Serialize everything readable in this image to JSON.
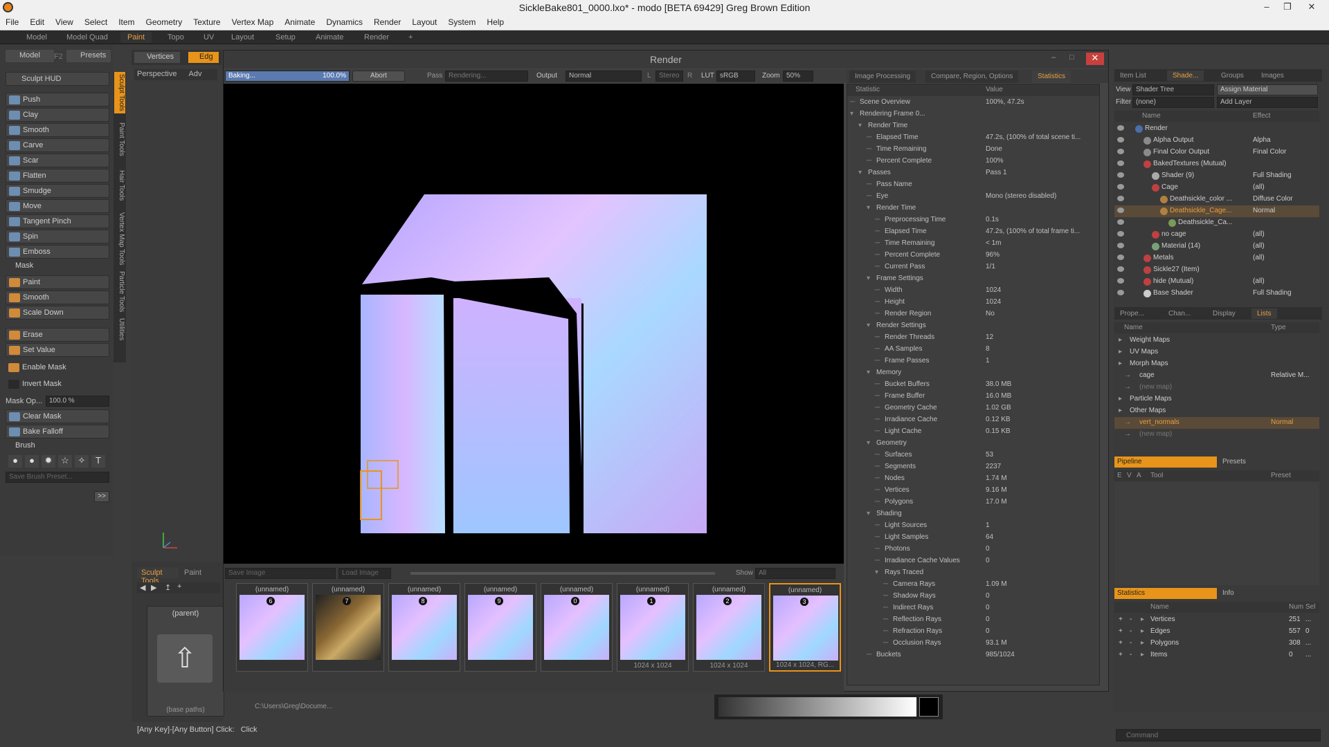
{
  "window": {
    "title": "SickleBake801_0000.lxo* - modo [BETA 69429] Greg Brown Edition"
  },
  "menu": [
    "File",
    "Edit",
    "View",
    "Select",
    "Item",
    "Geometry",
    "Texture",
    "Vertex Map",
    "Animate",
    "Dynamics",
    "Render",
    "Layout",
    "System",
    "Help"
  ],
  "layout_tabs": [
    "Model",
    "Model Quad",
    "Paint",
    "Topo",
    "UV",
    "Layout",
    "Setup",
    "Animate",
    "Render"
  ],
  "left": {
    "mode_tabs": [
      "Model",
      "F2",
      "Presets",
      "F6"
    ],
    "hud": "Sculpt HUD",
    "tools": [
      "Push",
      "Clay",
      "Smooth",
      "Carve",
      "Scar",
      "Flatten",
      "Smudge",
      "Move",
      "Tangent Pinch",
      "Spin",
      "Emboss"
    ],
    "mask_title": "Mask",
    "mask_tools": [
      "Paint",
      "Smooth",
      "Scale Down"
    ],
    "erase": "Erase",
    "set_value": "Set Value",
    "enable_mask": "Enable Mask",
    "invert_mask": "Invert Mask",
    "mask_opacity_label": "Mask Op...",
    "mask_opacity": "100.0 %",
    "clear_mask": "Clear Mask",
    "bake_falloff": "Bake Falloff",
    "brush_title": "Brush",
    "save_brush": "Save Brush Preset...",
    "vtabs": [
      "Sculpt Tools",
      "Paint Tools",
      "Hair Tools",
      "Vertex Map Tools",
      "Particle Tools",
      "Utilities"
    ],
    "bottom_tabs": [
      "Sculpt Tools",
      "Paint"
    ],
    "preset_label": "(parent)",
    "preset_path": "(base paths)"
  },
  "viewport": {
    "mode": "Perspective",
    "adv": "Adv",
    "sel_vertices": "Vertices",
    "sel_edges": "Edg"
  },
  "render": {
    "title": "Render",
    "progress_label": "Baking...",
    "progress_value": "100.0%",
    "progress_fraction": 1.0,
    "abort": "Abort",
    "pass_label": "Pass",
    "pass_value": "Rendering...",
    "output_label": "Output",
    "output_value": "Normal",
    "l": "L",
    "stereo": "Stereo",
    "r": "R",
    "lut_label": "LUT",
    "lut_value": "sRGB",
    "zoom_label": "Zoom",
    "zoom_value": "50%",
    "save_image": "Save Image",
    "load_image": "Load Image",
    "show_label": "Show",
    "show_value": "All",
    "tabs": [
      "Image Processing",
      "Compare, Region, Options",
      "Statistics"
    ],
    "stats_head": [
      "Statistic",
      "Value"
    ],
    "stats": [
      {
        "k": "Scene Overview",
        "v": "100%, 47.2s",
        "l": 0
      },
      {
        "k": "Rendering Frame 0...",
        "v": "",
        "l": 0
      },
      {
        "k": "Render Time",
        "v": "",
        "l": 1
      },
      {
        "k": "Elapsed Time",
        "v": "47.2s, (100% of total scene ti...",
        "l": 2
      },
      {
        "k": "Time Remaining",
        "v": "Done",
        "l": 2
      },
      {
        "k": "Percent Complete",
        "v": "100%",
        "l": 2
      },
      {
        "k": "Passes",
        "v": "Pass 1",
        "l": 1
      },
      {
        "k": "Pass Name",
        "v": "",
        "l": 2
      },
      {
        "k": "Eye",
        "v": "Mono (stereo disabled)",
        "l": 2
      },
      {
        "k": "Render Time",
        "v": "",
        "l": 2
      },
      {
        "k": "Preprocessing Time",
        "v": "0.1s",
        "l": 3
      },
      {
        "k": "Elapsed Time",
        "v": "47.2s, (100% of total frame ti...",
        "l": 3
      },
      {
        "k": "Time Remaining",
        "v": "< 1m",
        "l": 3
      },
      {
        "k": "Percent Complete",
        "v": "96%",
        "l": 3
      },
      {
        "k": "Current Pass",
        "v": "1/1",
        "l": 3
      },
      {
        "k": "Frame Settings",
        "v": "",
        "l": 2
      },
      {
        "k": "Width",
        "v": "1024",
        "l": 3
      },
      {
        "k": "Height",
        "v": "1024",
        "l": 3
      },
      {
        "k": "Render Region",
        "v": "No",
        "l": 3
      },
      {
        "k": "Render Settings",
        "v": "",
        "l": 2
      },
      {
        "k": "Render Threads",
        "v": "12",
        "l": 3
      },
      {
        "k": "AA Samples",
        "v": "8",
        "l": 3
      },
      {
        "k": "Frame Passes",
        "v": "1",
        "l": 3
      },
      {
        "k": "Memory",
        "v": "",
        "l": 2
      },
      {
        "k": "Bucket Buffers",
        "v": "38.0 MB",
        "l": 3
      },
      {
        "k": "Frame Buffer",
        "v": "16.0 MB",
        "l": 3
      },
      {
        "k": "Geometry Cache",
        "v": "1.02 GB",
        "l": 3
      },
      {
        "k": "Irradiance Cache",
        "v": "0.12 KB",
        "l": 3
      },
      {
        "k": "Light Cache",
        "v": "0.15 KB",
        "l": 3
      },
      {
        "k": "Geometry",
        "v": "",
        "l": 2
      },
      {
        "k": "Surfaces",
        "v": "53",
        "l": 3
      },
      {
        "k": "Segments",
        "v": "2237",
        "l": 3
      },
      {
        "k": "Nodes",
        "v": "1.74 M",
        "l": 3
      },
      {
        "k": "Vertices",
        "v": "9.16 M",
        "l": 3
      },
      {
        "k": "Polygons",
        "v": "17.0 M",
        "l": 3
      },
      {
        "k": "Shading",
        "v": "",
        "l": 2
      },
      {
        "k": "Light Sources",
        "v": "1",
        "l": 3
      },
      {
        "k": "Light Samples",
        "v": "64",
        "l": 3
      },
      {
        "k": "Photons",
        "v": "0",
        "l": 3
      },
      {
        "k": "Irradiance Cache Values",
        "v": "0",
        "l": 3
      },
      {
        "k": "Rays Traced",
        "v": "",
        "l": 3
      },
      {
        "k": "Camera Rays",
        "v": "1.09 M",
        "l": 4
      },
      {
        "k": "Shadow Rays",
        "v": "0",
        "l": 4
      },
      {
        "k": "Indirect Rays",
        "v": "0",
        "l": 4
      },
      {
        "k": "Reflection Rays",
        "v": "0",
        "l": 4
      },
      {
        "k": "Refraction Rays",
        "v": "0",
        "l": 4
      },
      {
        "k": "Occlusion Rays",
        "v": "93.1 M",
        "l": 4
      },
      {
        "k": "Buckets",
        "v": "985/1024",
        "l": 2
      }
    ],
    "thumbs": [
      {
        "label": "(unnamed)",
        "num": "6",
        "size": ""
      },
      {
        "label": "(unnamed)",
        "num": "7",
        "size": ""
      },
      {
        "label": "(unnamed)",
        "num": "8",
        "size": ""
      },
      {
        "label": "(unnamed)",
        "num": "9",
        "size": ""
      },
      {
        "label": "(unnamed)",
        "num": "0",
        "size": ""
      },
      {
        "label": "(unnamed)",
        "num": "1",
        "size": "1024 x 1024"
      },
      {
        "label": "(unnamed)",
        "num": "2",
        "size": "1024 x 1024"
      },
      {
        "label": "(unnamed)",
        "num": "3",
        "size": "1024 x 1024, RG..."
      }
    ]
  },
  "right": {
    "top_tabs": [
      "Item List",
      "Shade...",
      "Groups",
      "Images"
    ],
    "view_label": "View",
    "view_value": "Shader Tree",
    "assign_material": "Assign Material",
    "filter_label": "Filter",
    "filter_value": "(none)",
    "add_layer": "Add Layer",
    "cols": [
      "Name",
      "Effect"
    ],
    "items": [
      {
        "n": "Render",
        "e": "",
        "l": 0,
        "c": "#4a6ea8"
      },
      {
        "n": "Alpha Output",
        "e": "Alpha",
        "l": 1,
        "c": "#8a8a8a"
      },
      {
        "n": "Final Color Output",
        "e": "Final Color",
        "l": 1,
        "c": "#8a8a8a"
      },
      {
        "n": "BakedTextures (Mutual)",
        "e": "",
        "l": 1,
        "c": "#c04040"
      },
      {
        "n": "Shader (9)",
        "e": "Full Shading",
        "l": 2,
        "c": "#aaaaaa"
      },
      {
        "n": "Cage",
        "e": "(all)",
        "l": 2,
        "c": "#c04040"
      },
      {
        "n": "Deathsickle_color ...",
        "e": "Diffuse Color",
        "l": 3,
        "c": "#b08040"
      },
      {
        "n": "Deathsickle_Cage...",
        "e": "Normal",
        "l": 3,
        "c": "#b08040"
      },
      {
        "n": "Deathsickle_Ca...",
        "e": "",
        "l": 4,
        "c": "#7a9a5a"
      },
      {
        "n": "no cage",
        "e": "(all)",
        "l": 2,
        "c": "#c04040"
      },
      {
        "n": "Material (14)",
        "e": "(all)",
        "l": 2,
        "c": "#7aa07a"
      },
      {
        "n": "Metals",
        "e": "(all)",
        "l": 1,
        "c": "#c04040"
      },
      {
        "n": "Sickle27 (Item)",
        "e": "",
        "l": 1,
        "c": "#c04040"
      },
      {
        "n": "hide (Mutual)",
        "e": "(all)",
        "l": 1,
        "c": "#c04040"
      },
      {
        "n": "Base Shader",
        "e": "Full Shading",
        "l": 1,
        "c": "#cccccc"
      }
    ],
    "mid_tabs": [
      "Prope...",
      "Chan...",
      "Display",
      "Lists"
    ],
    "list_cols": [
      "Name",
      "Type"
    ],
    "lists": [
      {
        "n": "Weight Maps",
        "t": "",
        "l": 0
      },
      {
        "n": "UV Maps",
        "t": "",
        "l": 0
      },
      {
        "n": "Morph Maps",
        "t": "",
        "l": 0
      },
      {
        "n": "cage",
        "t": "Relative M...",
        "l": 1
      },
      {
        "n": "(new map)",
        "t": "",
        "l": 1
      },
      {
        "n": "Particle Maps",
        "t": "",
        "l": 0
      },
      {
        "n": "Other Maps",
        "t": "",
        "l": 0
      },
      {
        "n": "vert_normals",
        "t": "Normal",
        "l": 1
      },
      {
        "n": "(new map)",
        "t": "",
        "l": 1
      }
    ],
    "pipeline_tabs": [
      "Pipeline",
      "Presets"
    ],
    "pipeline_cols": [
      "E",
      "V",
      "A",
      "Tool",
      "Preset"
    ],
    "stats_tabs": [
      "Statistics",
      "Info"
    ],
    "stat_cols": [
      "Name",
      "Num",
      "Sel"
    ],
    "stat_rows": [
      {
        "n": "Vertices",
        "num": "251",
        "sel": "..."
      },
      {
        "n": "Edges",
        "num": "557",
        "sel": "0"
      },
      {
        "n": "Polygons",
        "num": "308",
        "sel": "..."
      },
      {
        "n": "Items",
        "num": "0",
        "sel": "..."
      }
    ],
    "command_placeholder": "Command"
  },
  "status": {
    "hint": "[Any Key]-[Any Button] Click:",
    "action": "Click",
    "path": "C:\\Users\\Greg\\Docume..."
  },
  "colors": {
    "accent": "#e8941a",
    "selected": "#5a4a38"
  }
}
